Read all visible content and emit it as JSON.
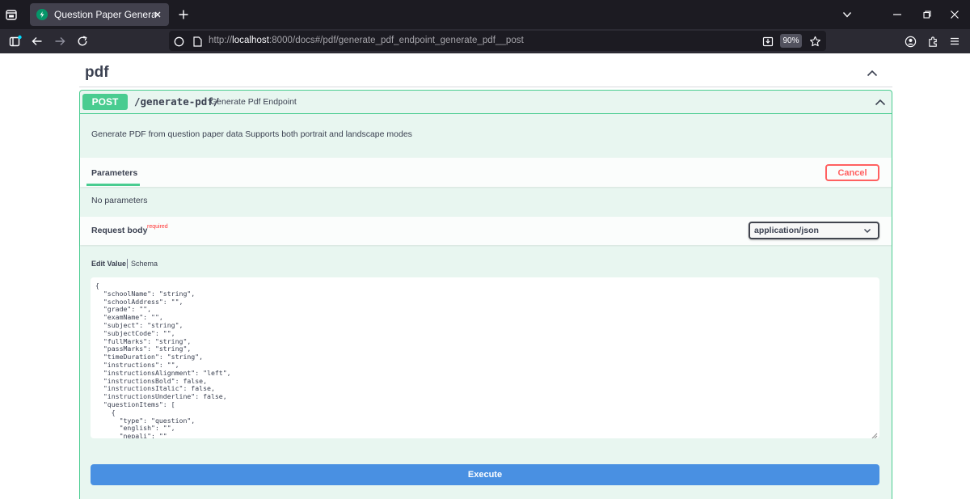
{
  "browser": {
    "tab_title": "Question Paper Generator API -",
    "url_prefix": "http://",
    "url_host": "localhost",
    "url_rest": ":8000/docs#/pdf/generate_pdf_endpoint_generate_pdf__post",
    "zoom": "90%"
  },
  "tag": {
    "title": "pdf"
  },
  "operation": {
    "method": "POST",
    "path": "/generate-pdf/",
    "summary": "Generate Pdf Endpoint",
    "description": "Generate PDF from question paper data Supports both portrait and landscape modes"
  },
  "parameters": {
    "tab_label": "Parameters",
    "cancel_label": "Cancel",
    "empty_text": "No parameters"
  },
  "request_body": {
    "title": "Request body",
    "required_label": "required",
    "content_type": "application/json",
    "edit_tab": "Edit Value",
    "schema_tab": "Schema",
    "code_lines": [
      "{",
      "  \"schoolName\": \"string\",",
      "  \"schoolAddress\": \"\",",
      "  \"grade\": \"\",",
      "  \"examName\": \"\",",
      "  \"subject\": \"string\",",
      "  \"subjectCode\": \"\",",
      "  \"fullMarks\": \"string\",",
      "  \"passMarks\": \"string\",",
      "  \"timeDuration\": \"string\",",
      "  \"instructions\": \"\",",
      "  \"instructionsAlignment\": \"left\",",
      "  \"instructionsBold\": false,",
      "  \"instructionsItalic\": false,",
      "  \"instructionsUnderline\": false,",
      "  \"questionItems\": [",
      "    {",
      "      \"type\": \"question\",",
      "      \"english\": \"\",",
      "      \"nepali\": \"\""
    ]
  },
  "execute_label": "Execute"
}
